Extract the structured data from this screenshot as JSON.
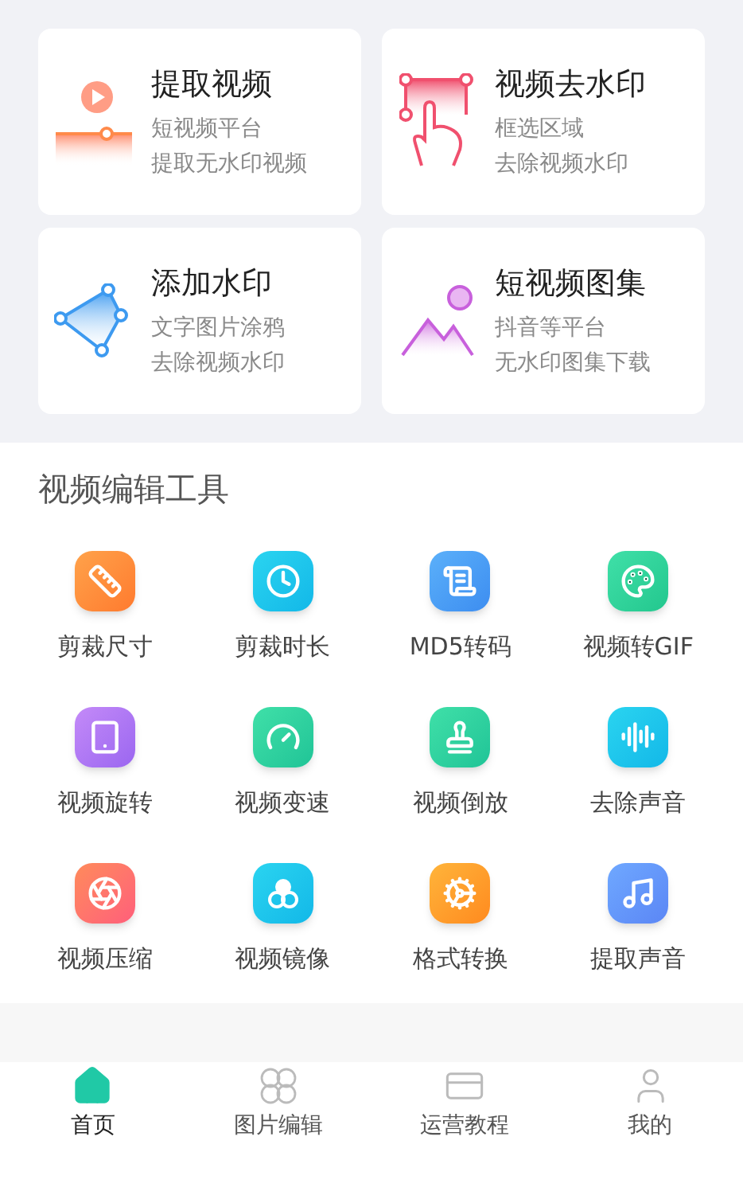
{
  "feature_cards": [
    {
      "kind": "extract",
      "title": "提取视频",
      "lines": [
        "短视频平台",
        "提取无水印视频"
      ]
    },
    {
      "kind": "remove",
      "title": "视频去水印",
      "lines": [
        "框选区域",
        "去除视频水印"
      ]
    },
    {
      "kind": "add",
      "title": "添加水印",
      "lines": [
        "文字图片涂鸦",
        "去除视频水印"
      ]
    },
    {
      "kind": "gallery",
      "title": "短视频图集",
      "lines": [
        "抖音等平台",
        "无水印图集下载"
      ]
    }
  ],
  "tools_section": {
    "title": "视频编辑工具",
    "tools": [
      {
        "kind": "ruler",
        "label": "剪裁尺寸"
      },
      {
        "kind": "clock",
        "label": "剪裁时长"
      },
      {
        "kind": "scroll",
        "label": "MD5转码"
      },
      {
        "kind": "palette",
        "label": "视频转GIF"
      },
      {
        "kind": "screen",
        "label": "视频旋转"
      },
      {
        "kind": "gauge",
        "label": "视频变速"
      },
      {
        "kind": "stamp",
        "label": "视频倒放"
      },
      {
        "kind": "audio",
        "label": "去除声音"
      },
      {
        "kind": "disc",
        "label": "视频压缩"
      },
      {
        "kind": "circles",
        "label": "视频镜像"
      },
      {
        "kind": "gear",
        "label": "格式转换"
      },
      {
        "kind": "music",
        "label": "提取声音"
      }
    ]
  },
  "tab_bar": [
    {
      "kind": "home",
      "label": "首页",
      "selected": true
    },
    {
      "kind": "grid",
      "label": "图片编辑",
      "selected": false
    },
    {
      "kind": "card",
      "label": "运营教程",
      "selected": false
    },
    {
      "kind": "user",
      "label": "我的",
      "selected": false
    }
  ]
}
